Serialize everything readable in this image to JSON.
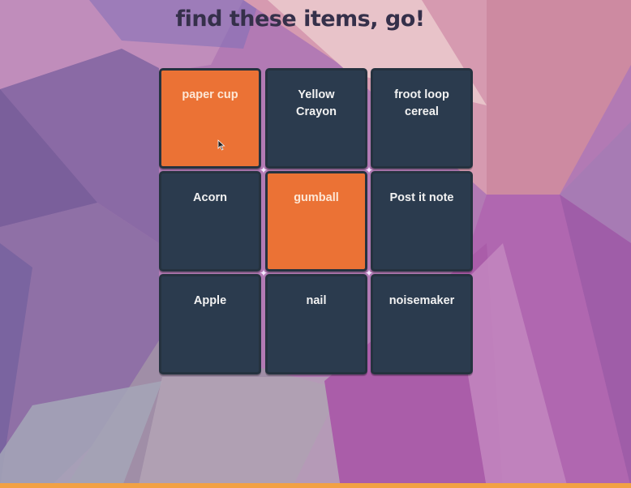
{
  "title": "find these items, go!",
  "colors": {
    "tile": "#2b3b4e",
    "tile_marked": "#eb7235",
    "title": "#35304a"
  },
  "tiles": [
    {
      "label": "paper cup",
      "marked": true
    },
    {
      "label": "Yellow\nCrayon",
      "marked": false
    },
    {
      "label": "froot loop\ncereal",
      "marked": false
    },
    {
      "label": "Acorn",
      "marked": false
    },
    {
      "label": "gumball",
      "marked": true
    },
    {
      "label": "Post it note",
      "marked": false
    },
    {
      "label": "Apple",
      "marked": false
    },
    {
      "label": "nail",
      "marked": false
    },
    {
      "label": "noisemaker",
      "marked": false
    }
  ],
  "icons": {
    "sparkle": "four-point-star",
    "cursor": "mouse-pointer"
  }
}
